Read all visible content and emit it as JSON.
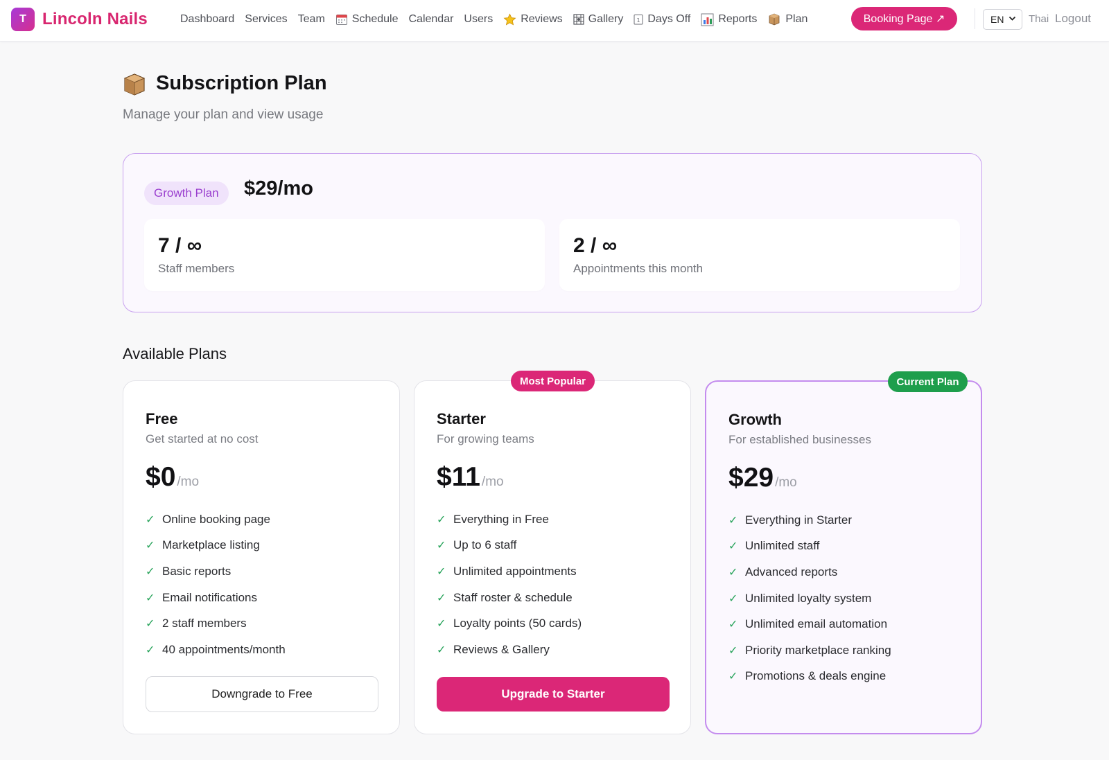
{
  "brand": {
    "initial": "T",
    "name": "Lincoln Nails"
  },
  "nav": {
    "items": [
      {
        "label": "Dashboard",
        "icon": ""
      },
      {
        "label": "Services",
        "icon": ""
      },
      {
        "label": "Team",
        "icon": ""
      },
      {
        "label": "Schedule",
        "icon": "calendar-icon"
      },
      {
        "label": "Calendar",
        "icon": ""
      },
      {
        "label": "Users",
        "icon": ""
      },
      {
        "label": "Reviews",
        "icon": "star-icon"
      },
      {
        "label": "Gallery",
        "icon": "gallery-icon"
      },
      {
        "label": "Days Off",
        "icon": "day-off-icon"
      },
      {
        "label": "Reports",
        "icon": "bar-chart-icon"
      },
      {
        "label": "Plan",
        "icon": "package-icon"
      }
    ],
    "booking_label": "Booking Page ↗",
    "language": "EN",
    "user": "Thai",
    "logout": "Logout"
  },
  "header": {
    "title": "Subscription Plan",
    "subtitle": "Manage your plan and view usage"
  },
  "current_plan": {
    "badge": "Growth Plan",
    "price": "$29/mo",
    "usage": [
      {
        "value": "7 / ∞",
        "label": "Staff members"
      },
      {
        "value": "2 / ∞",
        "label": "Appointments this month"
      }
    ]
  },
  "plans_section": {
    "title": "Available Plans"
  },
  "plans": [
    {
      "name": "Free",
      "description": "Get started at no cost",
      "price": "$0",
      "period": "/mo",
      "ribbon": "",
      "features": [
        "Online booking page",
        "Marketplace listing",
        "Basic reports",
        "Email notifications",
        "2 staff members",
        "40 appointments/month"
      ],
      "button": "Downgrade to Free"
    },
    {
      "name": "Starter",
      "description": "For growing teams",
      "price": "$11",
      "period": "/mo",
      "ribbon": "Most Popular",
      "features": [
        "Everything in Free",
        "Up to 6 staff",
        "Unlimited appointments",
        "Staff roster & schedule",
        "Loyalty points (50 cards)",
        "Reviews & Gallery"
      ],
      "button": "Upgrade to Starter"
    },
    {
      "name": "Growth",
      "description": "For established businesses",
      "price": "$29",
      "period": "/mo",
      "ribbon": "Current Plan",
      "features": [
        "Everything in Starter",
        "Unlimited staff",
        "Advanced reports",
        "Unlimited loyalty system",
        "Unlimited email automation",
        "Priority marketplace ranking",
        "Promotions & deals engine"
      ],
      "button": ""
    }
  ],
  "colors": {
    "accent": "#db2777",
    "purple": "#9a3fcf",
    "current": "#1e9e4c",
    "check": "#27a35a"
  }
}
